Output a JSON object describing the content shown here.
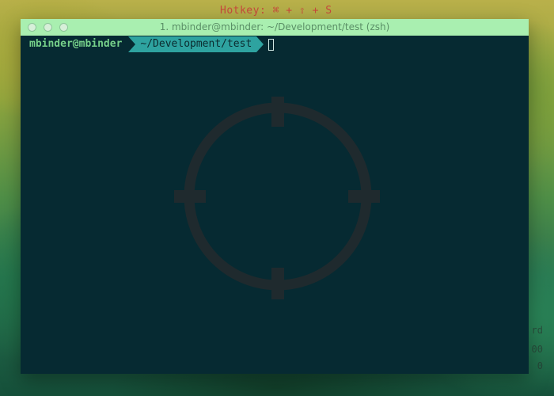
{
  "background": {
    "hotkey_label": "Hotkey: ⌘ + ⇧ + S",
    "side_text_1": "rd",
    "side_text_2": "00",
    "side_text_3": "0"
  },
  "window": {
    "title": "1. mbinder@mbinder: ~/Development/test (zsh)",
    "prompt": {
      "user": "mbinder@mbinder",
      "path": "~/Development/test"
    }
  },
  "colors": {
    "terminal_bg": "#062a32",
    "titlebar_bg": "#a9efb0",
    "user_fg": "#76d08a",
    "path_bg": "#2ea3a0",
    "crosshair": "#1f2a2e"
  },
  "icons": {
    "cursor": "crosshair-icon"
  }
}
